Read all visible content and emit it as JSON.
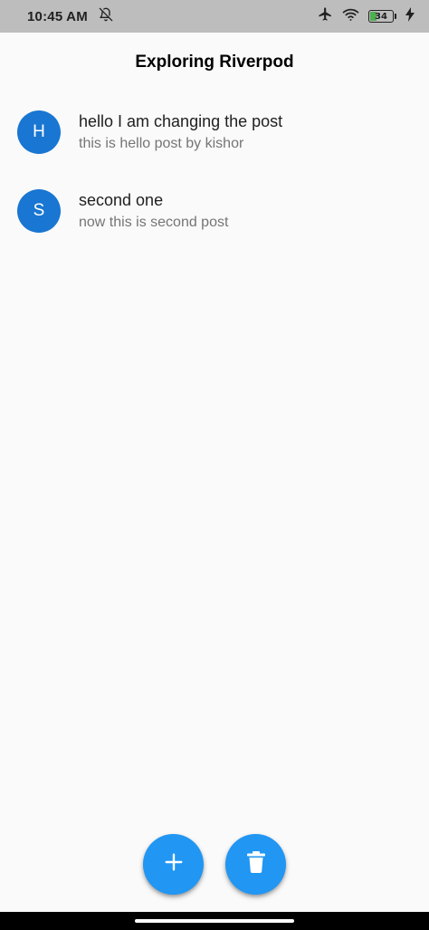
{
  "status_bar": {
    "time": "10:45 AM",
    "battery_level": "34",
    "battery_fraction": 0.34,
    "icons": [
      "bell-off-icon",
      "airplane-icon",
      "wifi-icon",
      "battery-icon",
      "charging-bolt-icon"
    ]
  },
  "app_bar": {
    "title": "Exploring Riverpod"
  },
  "posts": [
    {
      "initial": "H",
      "title": "hello I am changing the post",
      "subtitle": "this is hello post by kishor"
    },
    {
      "initial": "S",
      "title": "second one",
      "subtitle": "now this is second post"
    }
  ],
  "fabs": {
    "add_icon": "plus-icon",
    "delete_icon": "trash-icon"
  },
  "colors": {
    "avatar": "#1976d2",
    "fab": "#2196f3",
    "status_bar": "#bdbdbd",
    "battery_fill": "#4caf50"
  }
}
